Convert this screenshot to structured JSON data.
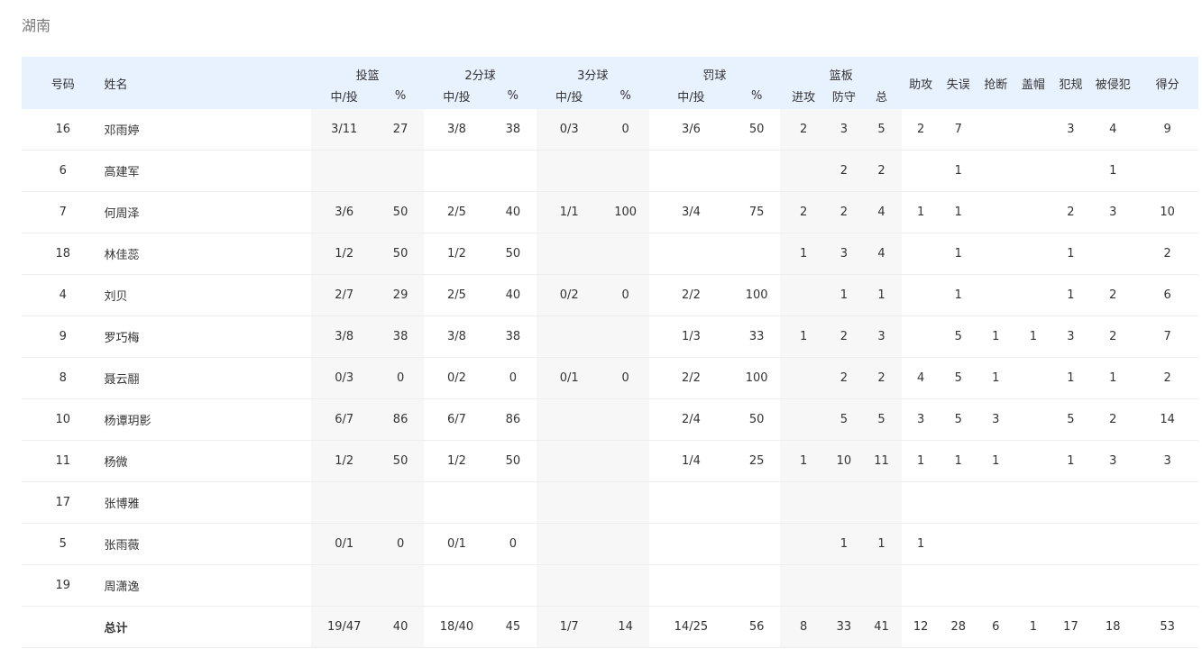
{
  "team_name": "湖南",
  "headers": {
    "number": "号码",
    "name": "姓名",
    "fg": "投篮",
    "two": "2分球",
    "three": "3分球",
    "ft": "罚球",
    "reb": "篮板",
    "made_att": "中/投",
    "pct": "%",
    "oreb": "进攻",
    "dreb": "防守",
    "treb": "总",
    "ast": "助攻",
    "tov": "失误",
    "stl": "抢断",
    "blk": "盖帽",
    "pf": "犯规",
    "fd": "被侵犯",
    "pts": "得分"
  },
  "rows": [
    {
      "num": "16",
      "name": "邓雨婷",
      "fg": "3/11",
      "fg_pct": "27",
      "two": "3/8",
      "two_pct": "38",
      "three": "0/3",
      "three_pct": "0",
      "ft": "3/6",
      "ft_pct": "50",
      "oreb": "2",
      "dreb": "3",
      "treb": "5",
      "ast": "2",
      "tov": "7",
      "stl": "",
      "blk": "",
      "pf": "3",
      "fd": "4",
      "pts": "9"
    },
    {
      "num": "6",
      "name": "高建军",
      "fg": "",
      "fg_pct": "",
      "two": "",
      "two_pct": "",
      "three": "",
      "three_pct": "",
      "ft": "",
      "ft_pct": "",
      "oreb": "",
      "dreb": "2",
      "treb": "2",
      "ast": "",
      "tov": "1",
      "stl": "",
      "blk": "",
      "pf": "",
      "fd": "1",
      "pts": ""
    },
    {
      "num": "7",
      "name": "何周泽",
      "fg": "3/6",
      "fg_pct": "50",
      "two": "2/5",
      "two_pct": "40",
      "three": "1/1",
      "three_pct": "100",
      "ft": "3/4",
      "ft_pct": "75",
      "oreb": "2",
      "dreb": "2",
      "treb": "4",
      "ast": "1",
      "tov": "1",
      "stl": "",
      "blk": "",
      "pf": "2",
      "fd": "3",
      "pts": "10"
    },
    {
      "num": "18",
      "name": "林佳蕊",
      "fg": "1/2",
      "fg_pct": "50",
      "two": "1/2",
      "two_pct": "50",
      "three": "",
      "three_pct": "",
      "ft": "",
      "ft_pct": "",
      "oreb": "1",
      "dreb": "3",
      "treb": "4",
      "ast": "",
      "tov": "1",
      "stl": "",
      "blk": "",
      "pf": "1",
      "fd": "",
      "pts": "2"
    },
    {
      "num": "4",
      "name": "刘贝",
      "fg": "2/7",
      "fg_pct": "29",
      "two": "2/5",
      "two_pct": "40",
      "three": "0/2",
      "three_pct": "0",
      "ft": "2/2",
      "ft_pct": "100",
      "oreb": "",
      "dreb": "1",
      "treb": "1",
      "ast": "",
      "tov": "1",
      "stl": "",
      "blk": "",
      "pf": "1",
      "fd": "2",
      "pts": "6"
    },
    {
      "num": "9",
      "name": "罗巧梅",
      "fg": "3/8",
      "fg_pct": "38",
      "two": "3/8",
      "two_pct": "38",
      "three": "",
      "three_pct": "",
      "ft": "1/3",
      "ft_pct": "33",
      "oreb": "1",
      "dreb": "2",
      "treb": "3",
      "ast": "",
      "tov": "5",
      "stl": "1",
      "blk": "1",
      "pf": "3",
      "fd": "2",
      "pts": "7"
    },
    {
      "num": "8",
      "name": "聂云翮",
      "fg": "0/3",
      "fg_pct": "0",
      "two": "0/2",
      "two_pct": "0",
      "three": "0/1",
      "three_pct": "0",
      "ft": "2/2",
      "ft_pct": "100",
      "oreb": "",
      "dreb": "2",
      "treb": "2",
      "ast": "4",
      "tov": "5",
      "stl": "1",
      "blk": "",
      "pf": "1",
      "fd": "1",
      "pts": "2"
    },
    {
      "num": "10",
      "name": "杨谭玥影",
      "fg": "6/7",
      "fg_pct": "86",
      "two": "6/7",
      "two_pct": "86",
      "three": "",
      "three_pct": "",
      "ft": "2/4",
      "ft_pct": "50",
      "oreb": "",
      "dreb": "5",
      "treb": "5",
      "ast": "3",
      "tov": "5",
      "stl": "3",
      "blk": "",
      "pf": "5",
      "fd": "2",
      "pts": "14"
    },
    {
      "num": "11",
      "name": "杨微",
      "fg": "1/2",
      "fg_pct": "50",
      "two": "1/2",
      "two_pct": "50",
      "three": "",
      "three_pct": "",
      "ft": "1/4",
      "ft_pct": "25",
      "oreb": "1",
      "dreb": "10",
      "treb": "11",
      "ast": "1",
      "tov": "1",
      "stl": "1",
      "blk": "",
      "pf": "1",
      "fd": "3",
      "pts": "3"
    },
    {
      "num": "17",
      "name": "张博雅",
      "fg": "",
      "fg_pct": "",
      "two": "",
      "two_pct": "",
      "three": "",
      "three_pct": "",
      "ft": "",
      "ft_pct": "",
      "oreb": "",
      "dreb": "",
      "treb": "",
      "ast": "",
      "tov": "",
      "stl": "",
      "blk": "",
      "pf": "",
      "fd": "",
      "pts": ""
    },
    {
      "num": "5",
      "name": "张雨薇",
      "fg": "0/1",
      "fg_pct": "0",
      "two": "0/1",
      "two_pct": "0",
      "three": "",
      "three_pct": "",
      "ft": "",
      "ft_pct": "",
      "oreb": "",
      "dreb": "1",
      "treb": "1",
      "ast": "1",
      "tov": "",
      "stl": "",
      "blk": "",
      "pf": "",
      "fd": "",
      "pts": ""
    },
    {
      "num": "19",
      "name": "周潇逸",
      "fg": "",
      "fg_pct": "",
      "two": "",
      "two_pct": "",
      "three": "",
      "three_pct": "",
      "ft": "",
      "ft_pct": "",
      "oreb": "",
      "dreb": "",
      "treb": "",
      "ast": "",
      "tov": "",
      "stl": "",
      "blk": "",
      "pf": "",
      "fd": "",
      "pts": ""
    }
  ],
  "totals": {
    "num": "",
    "name": "总计",
    "fg": "19/47",
    "fg_pct": "40",
    "two": "18/40",
    "two_pct": "45",
    "three": "1/7",
    "three_pct": "14",
    "ft": "14/25",
    "ft_pct": "56",
    "oreb": "8",
    "dreb": "33",
    "treb": "41",
    "ast": "12",
    "tov": "28",
    "stl": "6",
    "blk": "1",
    "pf": "17",
    "fd": "18",
    "pts": "53"
  }
}
